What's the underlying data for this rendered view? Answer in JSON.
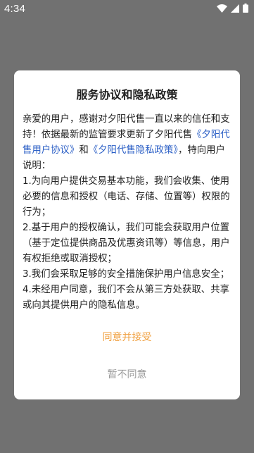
{
  "status_bar": {
    "time": "4:34",
    "icons": [
      "wifi-icon",
      "signal-icon",
      "battery-icon"
    ]
  },
  "dialog": {
    "title": "服务协议和隐私政策",
    "intro_prefix": "亲爱的用户，感谢对夕阳代售一直以来的信任和支持！依据最新的监管要求更新了夕阳代售",
    "user_agreement_link": "《夕阳代售用户协议》",
    "and_text": "和",
    "privacy_policy_link": "《夕阳代售隐私政策》",
    "intro_suffix": "，特向用户说明：",
    "points": [
      "1.为向用户提供交易基本功能，我们会收集、使用必要的信息和授权（电话、存储、位置等）权限的行为；",
      "2.基于用户的授权确认，我们可能会获取用户位置（基于定位提供商品及优惠资讯等）等信息，用户有权拒绝或取消授权；",
      "3.我们会采取足够的安全措施保护用户信息安全；",
      "4.未经用户同意，我们不会从第三方处获取、共享或向其提供用户的隐私信息。"
    ],
    "accept_label": "同意并接受",
    "reject_label": "暂不同意"
  },
  "colors": {
    "overlay": "#717171",
    "link": "#2b5fc6",
    "accept": "#f0a040",
    "reject": "#9a9a9a"
  }
}
